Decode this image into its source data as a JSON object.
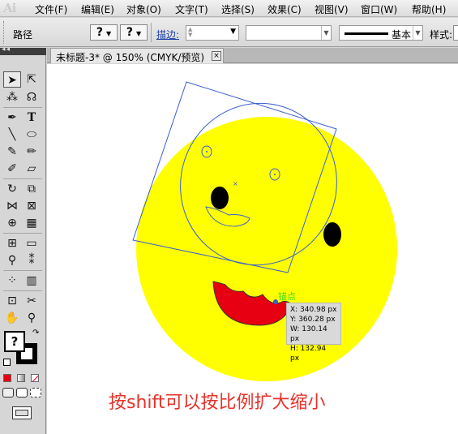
{
  "app": {
    "logo": "Ai"
  },
  "menu": [
    {
      "label": "文件(F)"
    },
    {
      "label": "编辑(E)"
    },
    {
      "label": "对象(O)"
    },
    {
      "label": "文字(T)"
    },
    {
      "label": "选择(S)"
    },
    {
      "label": "效果(C)"
    },
    {
      "label": "视图(V)"
    },
    {
      "label": "窗口(W)"
    },
    {
      "label": "帮助(H)"
    }
  ],
  "control": {
    "selection_label": "路径",
    "fill_swatch": "?",
    "stroke_swatch": "?",
    "stroke_label": "描边:",
    "stroke_weight": "",
    "variable_width": "",
    "stroke_profile": "基本",
    "style_label": "样式:"
  },
  "document": {
    "tab_title": "未标题-3* @ 150% (CMYK/预览)",
    "close_glyph": "×"
  },
  "tools": {
    "fill_glyph": "?"
  },
  "canvas": {
    "anchor_label": "锚点",
    "info": {
      "x": "X: 340.98 px",
      "y": "Y: 360.28 px",
      "w": "W: 130.14 px",
      "h": "H: 132.94 px"
    },
    "caption": "按shift可以按比例扩大缩小"
  },
  "colors": {
    "face": "#ffff00",
    "mouth": "#e60012",
    "selection": "#3a5fd0",
    "caption": "#e8322a",
    "anchor": "#44dd22"
  }
}
